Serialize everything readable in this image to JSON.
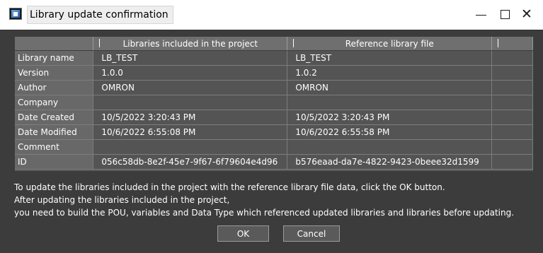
{
  "window": {
    "title": "Library update confirmation",
    "minimize_label": "—",
    "maximize_label": "☐",
    "close_label": "✕"
  },
  "table": {
    "columns": [
      "",
      "Libraries included in the project",
      "Reference library file",
      ""
    ],
    "rows": [
      {
        "label": "Library name",
        "project": "LB_TEST",
        "reference": "LB_TEST"
      },
      {
        "label": "Version",
        "project": "1.0.0",
        "reference": "1.0.2"
      },
      {
        "label": "Author",
        "project": "OMRON",
        "reference": "OMRON"
      },
      {
        "label": "Company",
        "project": "",
        "reference": ""
      },
      {
        "label": "Date Created",
        "project": "10/5/2022 3:20:43 PM",
        "reference": "10/5/2022 3:20:43 PM"
      },
      {
        "label": "Date Modified",
        "project": "10/6/2022 6:55:08 PM",
        "reference": "10/6/2022 6:55:58 PM"
      },
      {
        "label": "Comment",
        "project": "",
        "reference": ""
      },
      {
        "label": "ID",
        "project": "056c58db-8e2f-45e7-9f67-6f79604e4d96",
        "reference": "b576eaad-da7e-4822-9423-0beee32d1599"
      }
    ]
  },
  "message": {
    "line1": "To update the libraries included in the project with the reference library file data, click the OK button.",
    "line2": "After updating the libraries included in the project,",
    "line3": "you need to build the POU, variables and Data Type which referenced updated libraries and libraries before updating."
  },
  "buttons": {
    "ok": "OK",
    "cancel": "Cancel"
  },
  "colors": {
    "window_bg": "#3c3c3c",
    "header_bg": "#6f6f6f",
    "cell_bg": "#545454",
    "label_bg": "#686868"
  }
}
